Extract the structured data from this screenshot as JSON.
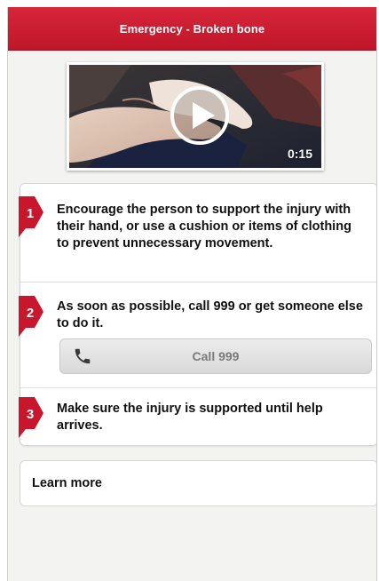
{
  "header": {
    "title": "Emergency - Broken bone"
  },
  "video": {
    "duration": "0:15",
    "play_icon": "play-icon"
  },
  "steps": [
    {
      "number": "1",
      "text": "Encourage the person to support the injury with their hand, or use a cushion or items of clothing to prevent unnecessary movement."
    },
    {
      "number": "2",
      "text": "As soon as possible, call 999 or get someone else to do it."
    },
    {
      "number": "3",
      "text": "Make sure the injury is supported until help arrives."
    }
  ],
  "call_button": {
    "label": "Call 999",
    "icon": "phone-icon"
  },
  "learn_more": {
    "label": "Learn more"
  },
  "colors": {
    "brand_red": "#c8172c",
    "background": "#f3f3f1",
    "button_text": "#7a7a7a"
  }
}
